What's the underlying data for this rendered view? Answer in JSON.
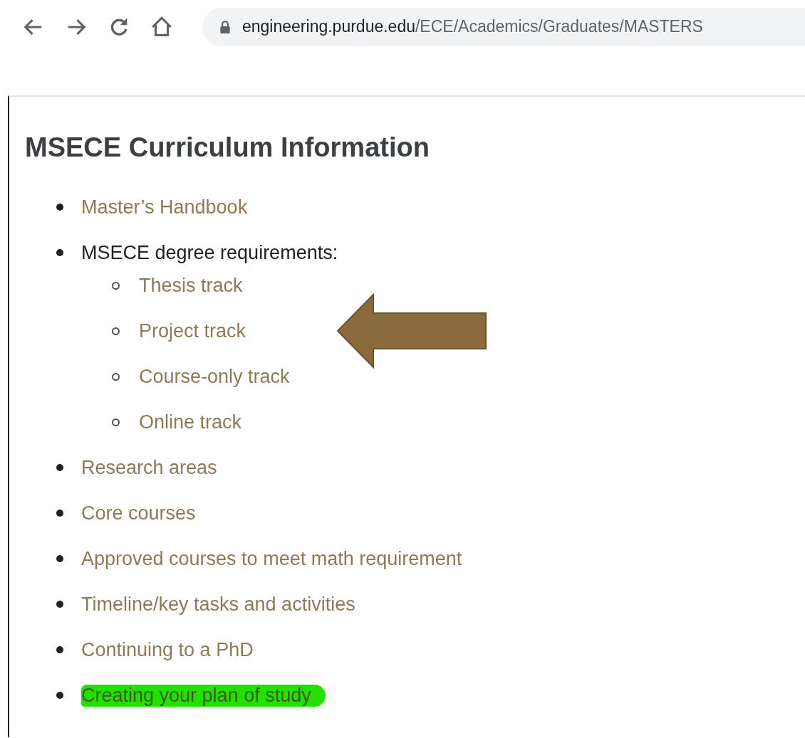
{
  "browser": {
    "url_domain": "engineering.purdue.edu",
    "url_path": "/ECE/Academics/Graduates/MASTERS"
  },
  "heading": "MSECE Curriculum Information",
  "items": [
    {
      "label": "Master’s Handbook",
      "kind": "link",
      "highlighted": false
    },
    {
      "label": "MSECE degree requirements:",
      "kind": "text",
      "highlighted": false,
      "children": [
        {
          "label": "Thesis track",
          "kind": "link",
          "arrow": false
        },
        {
          "label": "Project track",
          "kind": "link",
          "arrow": true
        },
        {
          "label": "Course-only track",
          "kind": "link",
          "arrow": false
        },
        {
          "label": "Online track",
          "kind": "link",
          "arrow": false
        }
      ]
    },
    {
      "label": "Research areas",
      "kind": "link",
      "highlighted": false
    },
    {
      "label": "Core courses",
      "kind": "link",
      "highlighted": false
    },
    {
      "label": "Approved courses to meet math requirement",
      "kind": "link",
      "highlighted": false
    },
    {
      "label": "Timeline/key tasks and activities",
      "kind": "link",
      "highlighted": false
    },
    {
      "label": "Continuing to a PhD",
      "kind": "link",
      "highlighted": false
    },
    {
      "label": "Creating your plan of study",
      "kind": "link",
      "highlighted": true
    }
  ]
}
